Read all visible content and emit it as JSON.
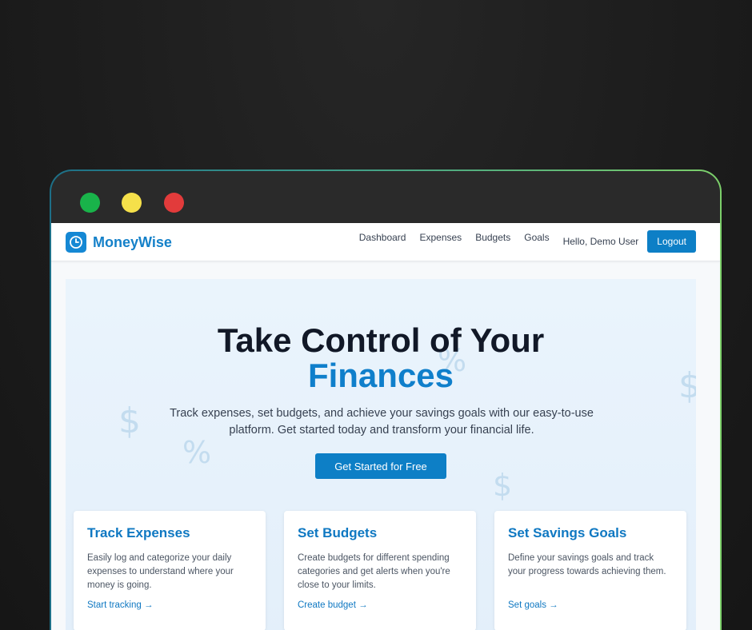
{
  "window": {
    "controls": [
      "green",
      "yellow",
      "red"
    ]
  },
  "brand": {
    "name": "MoneyWise",
    "icon": "clock-icon",
    "color": "#1581c9"
  },
  "nav": {
    "links": [
      "Dashboard",
      "Expenses",
      "Budgets",
      "Goals"
    ],
    "greeting": "Hello, Demo User",
    "logout": "Logout"
  },
  "hero": {
    "title_line1": "Take Control of Your",
    "title_line2": "Finances",
    "subtitle": "Track expenses, set budgets, and achieve your savings goals with our easy-to-use platform. Get started today and transform your financial life.",
    "cta": "Get Started for Free"
  },
  "features": [
    {
      "title": "Track Expenses",
      "description": "Easily log and categorize your daily expenses to understand where your money is going.",
      "link": "Start tracking →"
    },
    {
      "title": "Set Budgets",
      "description": "Create budgets for different spending categories and get alerts when you're close to your limits.",
      "link": "Create budget →"
    },
    {
      "title": "Set Savings Goals",
      "description": "Define your savings goals and track your progress towards achieving them.",
      "link": "Set goals →"
    }
  ],
  "colors": {
    "accent": "#0d7fc6",
    "frame_start": "#1d6f87",
    "frame_end": "#7ccf6a"
  }
}
